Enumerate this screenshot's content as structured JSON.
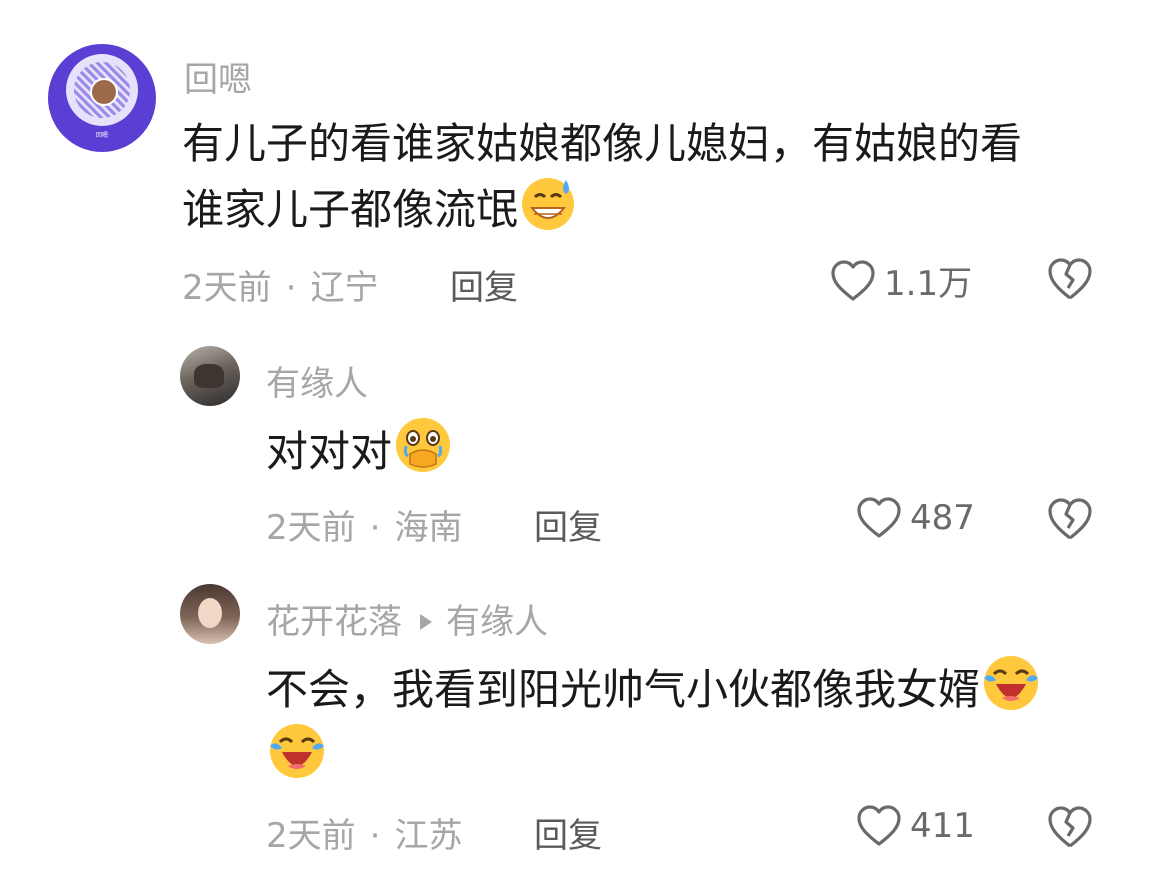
{
  "comments": [
    {
      "user": "回嗯",
      "avatar_text": "回嗯",
      "text_line1": "有儿子的看谁家姑娘都像儿媳妇，有姑娘的看",
      "text_line2": "谁家儿子都像流氓",
      "emoji": "sweat-grin-emoji",
      "time": "2天前",
      "location": "辽宁",
      "reply_label": "回复",
      "likes": "1.1万"
    },
    {
      "user": "有缘人",
      "text": "对对对",
      "emoji": "tearful-hand-over-mouth-emoji",
      "time": "2天前",
      "location": "海南",
      "reply_label": "回复",
      "likes": "487"
    },
    {
      "user": "花开花落",
      "reply_to": "有缘人",
      "text_line1": "不会，我看到阳光帅气小伙都像我女婿",
      "emoji": "laughing-crying-emoji",
      "time": "2天前",
      "location": "江苏",
      "reply_label": "回复",
      "likes": "411"
    }
  ],
  "separator": "·",
  "colors": {
    "meta": "#a6a6a6",
    "text": "#1a1a1a",
    "avatar_purple": "#5b3fd4"
  }
}
